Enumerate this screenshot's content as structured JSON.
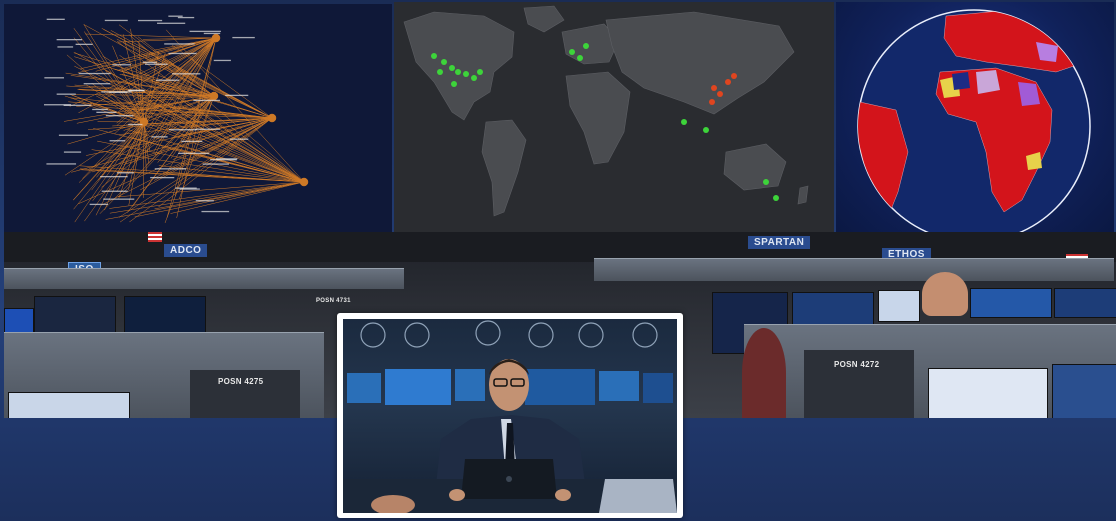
{
  "network_graph": {
    "caption": "",
    "node_color": "#f08a24"
  },
  "world_map": {
    "watermark": "",
    "land_color": "#4a4c50",
    "point_colors": [
      "#3dd43a",
      "#e0451f"
    ]
  },
  "globe": {
    "land_color": "#d3141b",
    "ocean_color": "#12286a"
  },
  "control_room": {
    "signs": {
      "adco": "ADCO",
      "iso": "ISO",
      "spartan": "SPARTAN",
      "ethos": "ETHOS"
    },
    "positions": {
      "left": "POSN 4275",
      "right": "POSN 4272",
      "top": "POSN 4731"
    }
  },
  "photo": {
    "subject": "man-at-laptop"
  }
}
